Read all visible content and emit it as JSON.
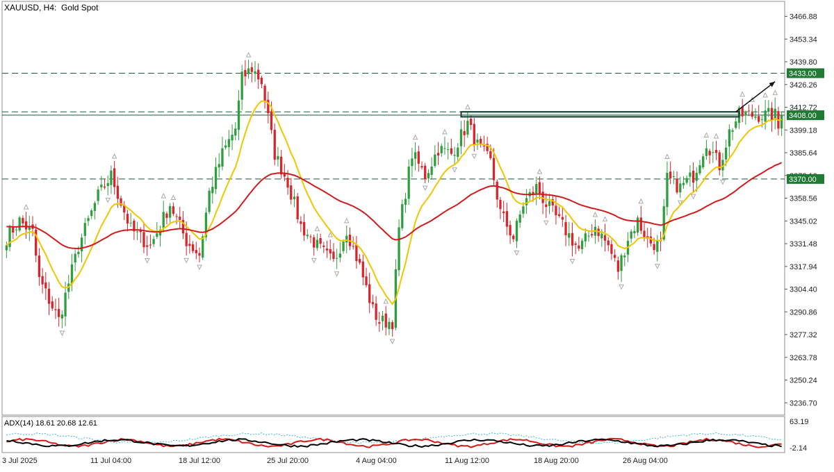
{
  "header": {
    "symbol": "XAUUSD, H4:",
    "description": "Gold Spot"
  },
  "adx": {
    "label": "ADX(14) 18.61 20.68 12.61",
    "scale_top": "63.19",
    "scale_bottom": "-2.14"
  },
  "colors": {
    "bull": "#2e9e3f",
    "bear": "#d6252c",
    "ma_fast": "#f2c500",
    "ma_slow": "#d11a1a",
    "level_line": "#1f5a3a",
    "zone_fill": "#1f6f5a",
    "label_bg": "#1f7a34",
    "adx_main": "#000000",
    "adx_plus": "#d11a1a",
    "adx_minus": "#3cb7d4",
    "fractal": "#a9a9a9"
  },
  "chart_data": {
    "type": "candlestick",
    "title": "XAUUSD, H4: Gold Spot",
    "ylim": [
      3225,
      3475
    ],
    "y_ticks": [
      "3466.88",
      "3453.34",
      "3439.80",
      "3426.26",
      "3412.72",
      "3399.18",
      "3385.64",
      "3372.10",
      "3358.56",
      "3345.02",
      "3331.48",
      "3317.94",
      "3304.40",
      "3290.86",
      "3277.32",
      "3263.78",
      "3250.24",
      "3236.70"
    ],
    "x_ticks": [
      "3 Jul 2025",
      "11 Jul 04:00",
      "18 Jul 12:00",
      "25 Jul 20:00",
      "4 Aug 04:00",
      "11 Aug 12:00",
      "18 Aug 20:00",
      "26 Aug 04:00"
    ],
    "levels": [
      {
        "price": 3433.0,
        "label": "3433.00",
        "style": "dashed",
        "highlight": true
      },
      {
        "price": 3410.0,
        "label": "",
        "style": "dashed",
        "highlight": false
      },
      {
        "price": 3408.0,
        "label": "3408.00",
        "style": "solid",
        "highlight": true
      },
      {
        "price": 3370.0,
        "label": "3370.00",
        "style": "dashed",
        "highlight": true
      }
    ],
    "resistance_zone": {
      "from_bar": 139,
      "to_bar": 224,
      "price_low": 3407,
      "price_high": 3410
    },
    "arrow": {
      "from_bar": 223,
      "from_price": 3410,
      "to_bar": 235,
      "to_price": 3428
    },
    "moving_averages": [
      {
        "name": "MA fast",
        "color_key": "ma_fast",
        "period": 50
      },
      {
        "name": "MA slow",
        "color_key": "ma_slow",
        "period": 200,
        "seed": 3342
      }
    ],
    "ohlc_control_closes": [
      [
        0,
        3335
      ],
      [
        4,
        3345
      ],
      [
        8,
        3338
      ],
      [
        10,
        3310
      ],
      [
        16,
        3286
      ],
      [
        22,
        3330
      ],
      [
        28,
        3360
      ],
      [
        32,
        3372
      ],
      [
        38,
        3340
      ],
      [
        44,
        3330
      ],
      [
        50,
        3355
      ],
      [
        55,
        3333
      ],
      [
        59,
        3325
      ],
      [
        62,
        3362
      ],
      [
        66,
        3385
      ],
      [
        70,
        3400
      ],
      [
        72,
        3430
      ],
      [
        75,
        3436
      ],
      [
        78,
        3428
      ],
      [
        82,
        3385
      ],
      [
        86,
        3368
      ],
      [
        90,
        3342
      ],
      [
        95,
        3330
      ],
      [
        100,
        3320
      ],
      [
        104,
        3340
      ],
      [
        108,
        3318
      ],
      [
        112,
        3292
      ],
      [
        114,
        3285
      ],
      [
        118,
        3285
      ],
      [
        120,
        3340
      ],
      [
        124,
        3385
      ],
      [
        128,
        3372
      ],
      [
        132,
        3388
      ],
      [
        136,
        3385
      ],
      [
        141,
        3403
      ],
      [
        144,
        3390
      ],
      [
        148,
        3380
      ],
      [
        151,
        3350
      ],
      [
        155,
        3335
      ],
      [
        158,
        3355
      ],
      [
        162,
        3365
      ],
      [
        165,
        3355
      ],
      [
        170,
        3342
      ],
      [
        175,
        3328
      ],
      [
        180,
        3342
      ],
      [
        184,
        3330
      ],
      [
        187,
        3316
      ],
      [
        190,
        3335
      ],
      [
        193,
        3345
      ],
      [
        196,
        3333
      ],
      [
        200,
        3330
      ],
      [
        202,
        3370
      ],
      [
        206,
        3365
      ],
      [
        210,
        3372
      ],
      [
        214,
        3392
      ],
      [
        218,
        3378
      ],
      [
        221,
        3398
      ],
      [
        224,
        3408
      ]
    ]
  }
}
